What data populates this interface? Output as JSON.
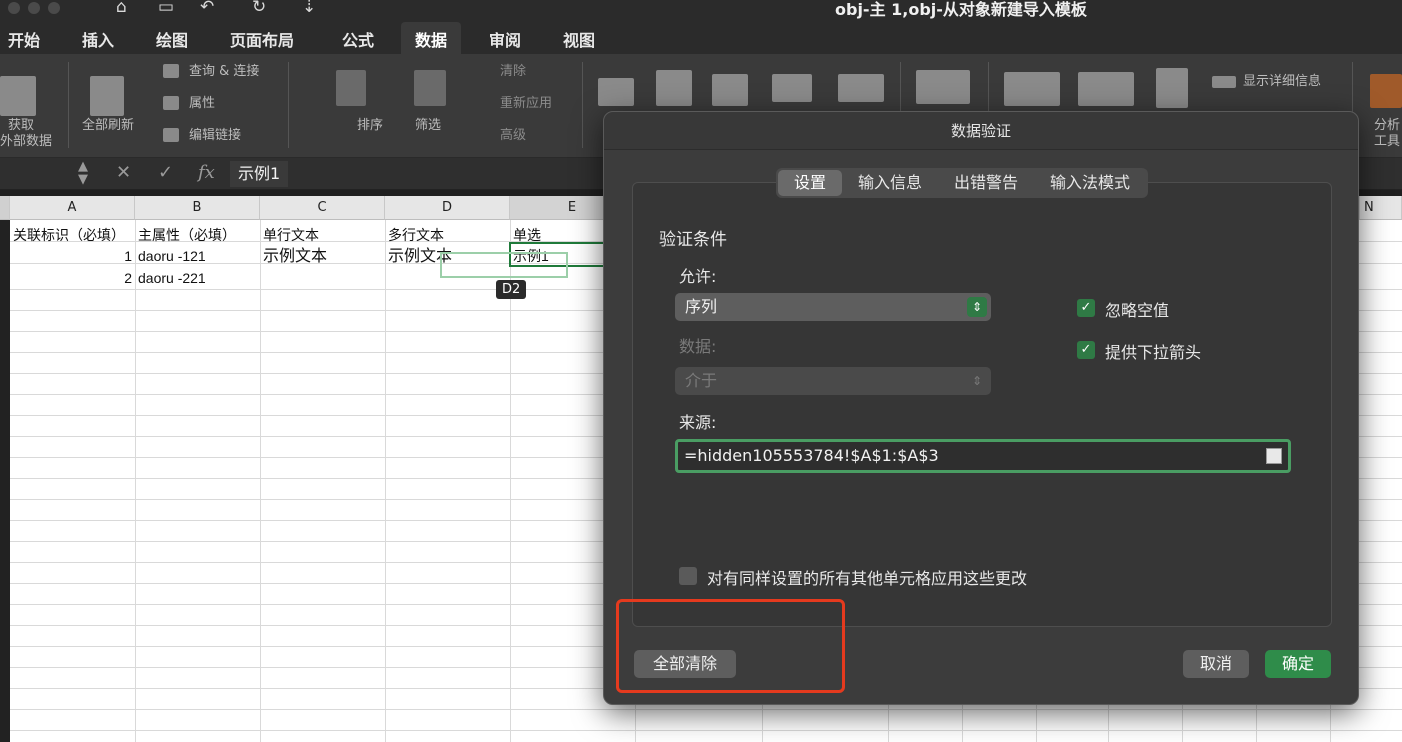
{
  "window": {
    "title": "obj-主 1,obj-从对象新建导入模板"
  },
  "ribbon_tabs": [
    {
      "label": "开始"
    },
    {
      "label": "插入"
    },
    {
      "label": "绘图"
    },
    {
      "label": "页面布局"
    },
    {
      "label": "公式"
    },
    {
      "label": "数据"
    },
    {
      "label": "审阅"
    },
    {
      "label": "视图"
    }
  ],
  "ribbon": {
    "get_data_1": "获取",
    "get_data_2": "外部数据",
    "refresh_all": "全部刷新",
    "query_connect": "查询 & 连接",
    "properties": "属性",
    "edit_links": "编辑链接",
    "sort": "排序",
    "filter": "筛选",
    "clear": "清除",
    "reapply": "重新应用",
    "advanced": "高级",
    "show_detail": "显示详细信息",
    "analysis_1": "分析",
    "analysis_2": "工具"
  },
  "formula_bar": {
    "value": "示例1"
  },
  "sheet": {
    "columns": [
      "A",
      "B",
      "C",
      "D",
      "E",
      "N"
    ],
    "row1": [
      "关联标识（必填）",
      "主属性（必填）",
      "单行文本",
      "多行文本",
      "单选"
    ],
    "row2": [
      "1",
      "daoru -121",
      "示例文本",
      "示例文本",
      "示例1"
    ],
    "row3": [
      "2",
      "daoru -221"
    ],
    "tooltip": "D2"
  },
  "dialog": {
    "title": "数据验证",
    "tabs": [
      {
        "label": "设置"
      },
      {
        "label": "输入信息"
      },
      {
        "label": "出错警告"
      },
      {
        "label": "输入法模式"
      }
    ],
    "section_title": "验证条件",
    "allow_label": "允许:",
    "allow_value": "序列",
    "data_label": "数据:",
    "data_value": "介于",
    "ignore_blank": "忽略空值",
    "dropdown_arrow": "提供下拉箭头",
    "source_label": "来源:",
    "source_value": "=hidden105553784!$A$1:$A$3",
    "apply_all": "对有同样设置的所有其他单元格应用这些更改",
    "clear_all": "全部清除",
    "cancel": "取消",
    "ok": "确定"
  }
}
